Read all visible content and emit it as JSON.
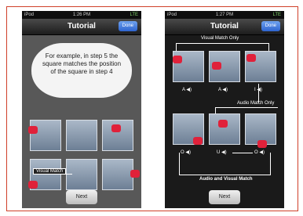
{
  "status": {
    "carrier": "iPod",
    "time_left": "1:26 PM",
    "time_right": "1:27 PM",
    "battery": "LTE"
  },
  "nav": {
    "title": "Tutorial",
    "done_label": "Done"
  },
  "left": {
    "cloud_text": "For example, in step 5 the square matches the position of the square in step 4",
    "visual_match_label": "Visual Match"
  },
  "right": {
    "visual_match_only": "Visual Match Only",
    "audio_match_only": "Audio Match Only",
    "audio_and_visual": "Audio and Visual Match",
    "letters_top": [
      "A",
      "A",
      "I"
    ],
    "letters_bottom": [
      "O",
      "U",
      "O"
    ]
  },
  "next_label": "Next",
  "colors": {
    "marker": "#e0213a",
    "frame": "#d0402a",
    "done": "#3b72dd"
  }
}
